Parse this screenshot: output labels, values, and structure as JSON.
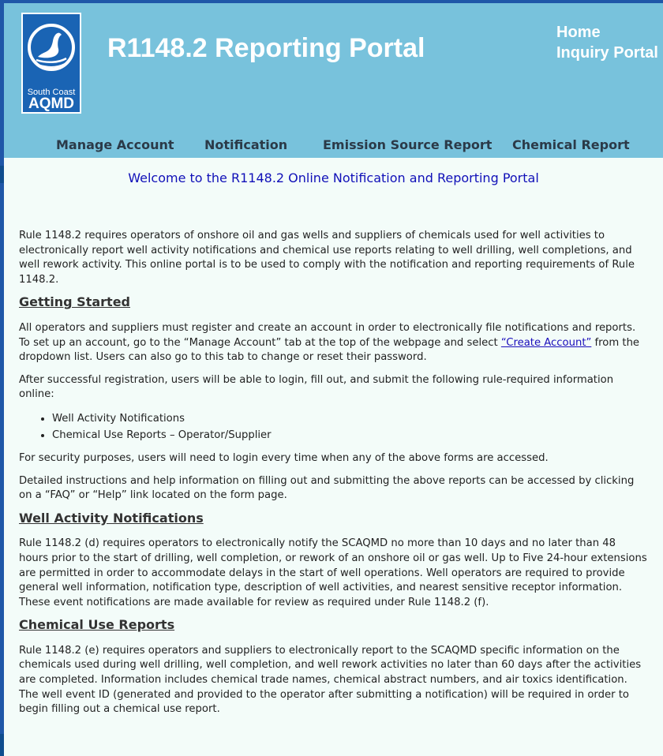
{
  "header": {
    "logo": {
      "line1": "South Coast",
      "line2": "AQMD"
    },
    "title": "R1148.2 Reporting Portal",
    "links": [
      "Home",
      "Inquiry Portal"
    ]
  },
  "nav": {
    "items": [
      "Manage Account",
      "Notification",
      "Emission Source Report",
      "Chemical Report"
    ]
  },
  "welcome": "Welcome to the R1148.2 Online Notification and Reporting Portal",
  "content": {
    "intro": "Rule 1148.2 requires operators of onshore oil and gas wells and suppliers of chemicals used for well activities to electronically report well activity notifications and chemical use reports relating to well drilling, well completions, and well rework activity. This online portal is to be used to comply with the notification and reporting requirements of Rule 1148.2.",
    "getting_started": {
      "heading": "Getting Started",
      "p1_before": "All operators and suppliers must register and create an account in order to electronically file notifications and reports. To set up an account, go to the “Manage Account” tab at the top of the webpage and select ",
      "p1_link": "“Create Account”",
      "p1_after": " from the dropdown list. Users can also go to this tab to change or reset their password.",
      "p2": "After successful registration, users will be able to login, fill out, and submit the following rule-required information online:",
      "list": [
        "Well Activity Notifications",
        "Chemical Use Reports – Operator/Supplier"
      ],
      "p3": "For security purposes, users will need to login every time when any of the above forms are accessed.",
      "p4": "Detailed instructions and help information on filling out and submitting the above reports can be accessed by clicking on a “FAQ” or “Help” link located on the form page."
    },
    "well_activity": {
      "heading": "Well Activity Notifications",
      "p": "Rule 1148.2 (d) requires operators to electronically notify the SCAQMD no more than 10 days and no later than 48 hours prior to the start of drilling, well completion, or rework of an onshore oil or gas well. Up to Five 24-hour extensions are permitted in order to accommodate delays in the start of well operations. Well operators are required to provide general well information, notification type, description of well activities, and nearest sensitive receptor information. These event notifications are made available for review as required under Rule 1148.2 (f)."
    },
    "chemical_use": {
      "heading": "Chemical Use Reports",
      "p": "Rule 1148.2 (e) requires operators and suppliers to electronically report to the SCAQMD specific information on the chemicals used during well drilling, well completion, and well rework activities no later than 60 days after the activities are completed. Information includes chemical trade names, chemical abstract numbers, and air toxics identification. The well event ID (generated and provided to the operator after submitting a notification) will be required in order to begin filling out a chemical use report."
    }
  },
  "colors": {
    "header_bg": "#78c2dc",
    "page_bg": "#f3fcf9",
    "welcome_text": "#1010b8",
    "link": "#1a0dbb",
    "outer_frame": "#1f57a8"
  }
}
